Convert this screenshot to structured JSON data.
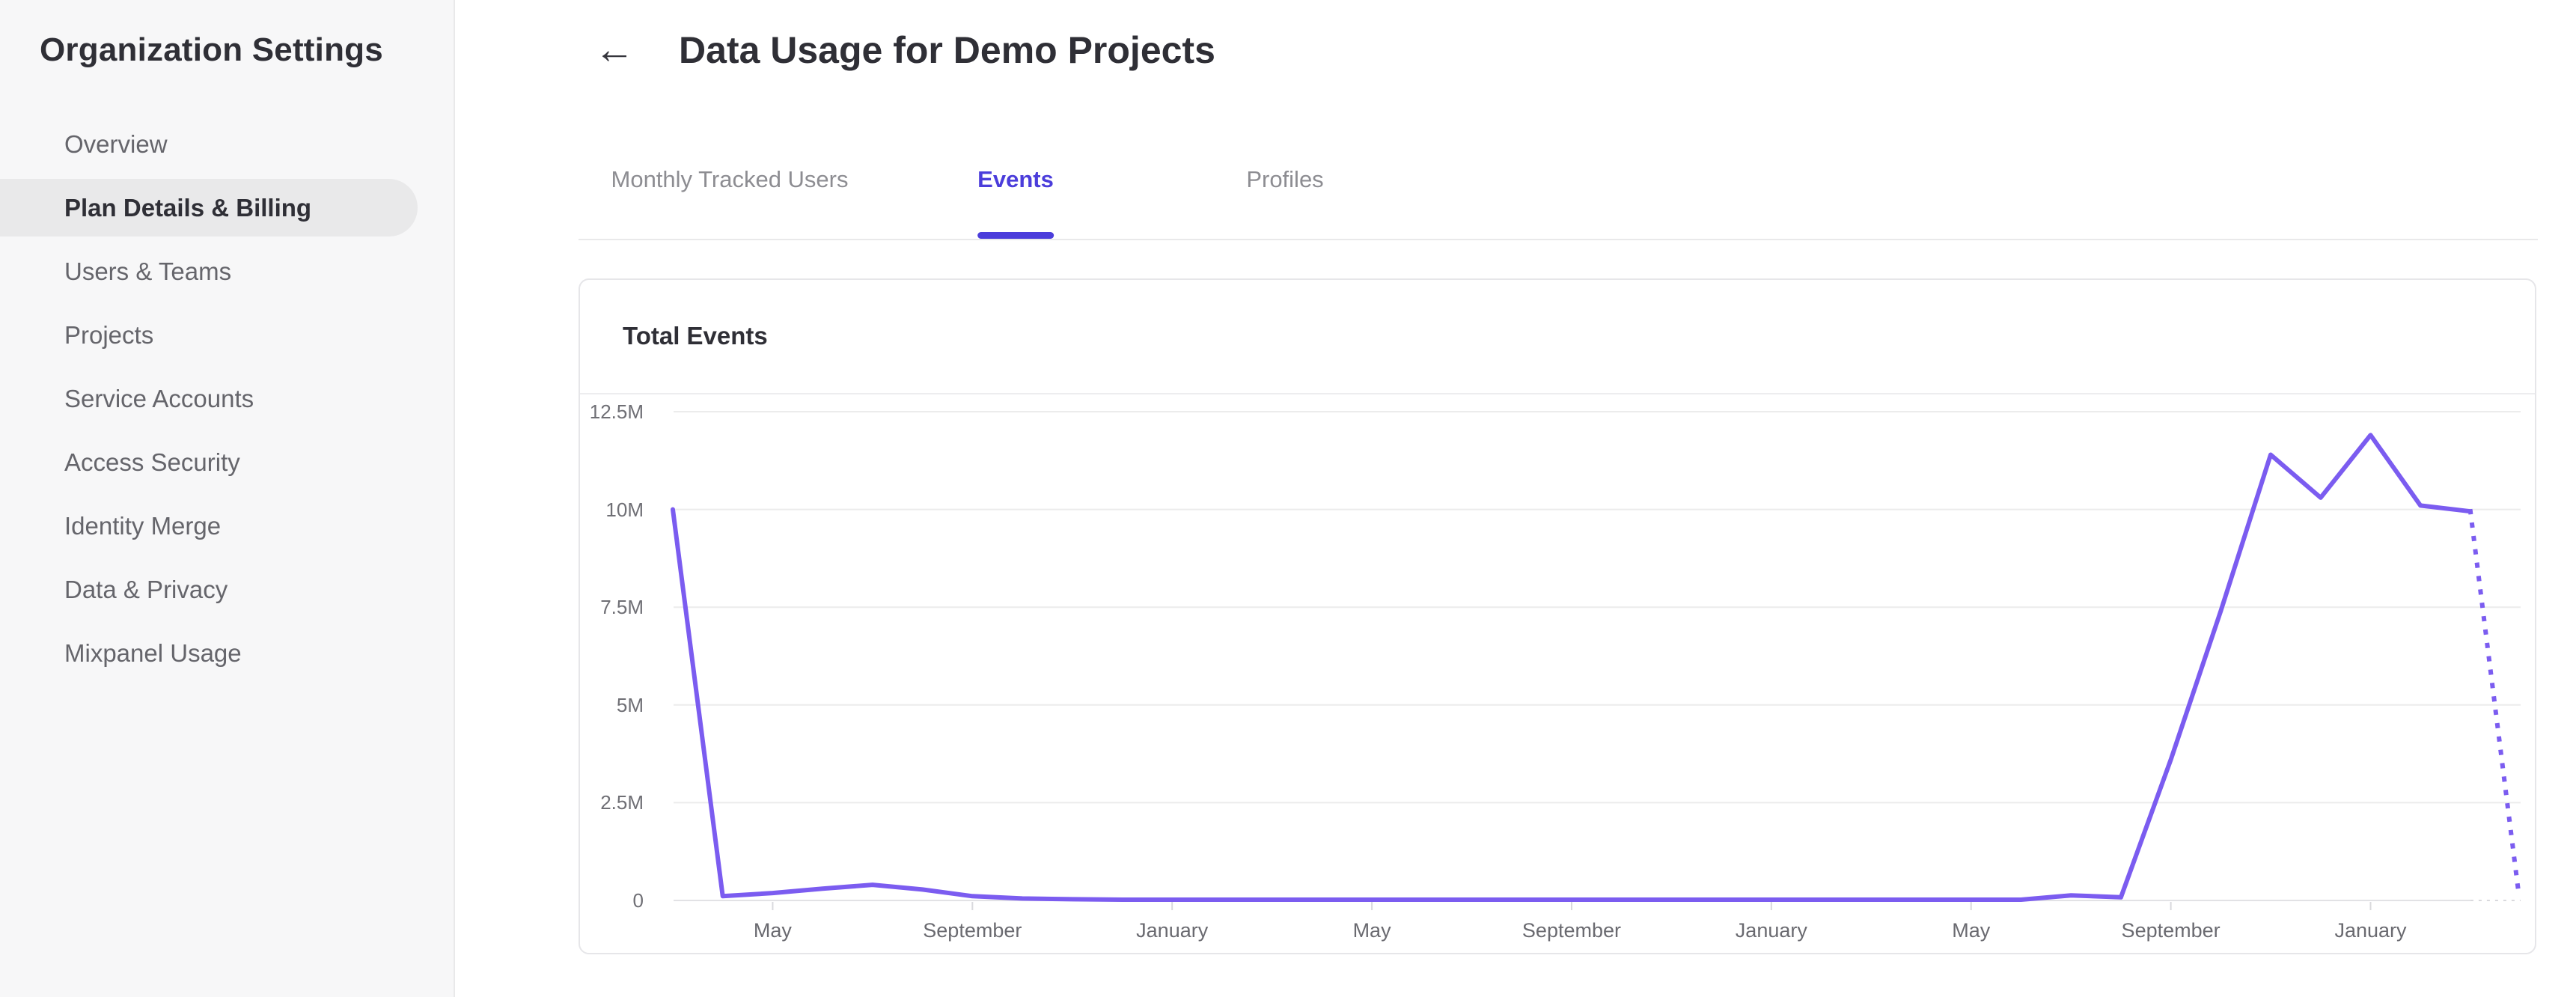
{
  "colors": {
    "accent": "#4b3ddb",
    "chart_line": "#7b5cf0",
    "sidebar_bg": "#f7f7f8",
    "pill": "#e9e9ea",
    "text_dark": "#2f2f36",
    "text_gray": "#65656b",
    "tab_inactive": "#8d8d92",
    "gridline": "#ececec",
    "axis_line": "#e2e2e5"
  },
  "sidebar": {
    "title": "Organization Settings",
    "items": [
      {
        "label": "Overview",
        "selected": false
      },
      {
        "label": "Plan Details & Billing",
        "selected": true
      },
      {
        "label": "Users & Teams",
        "selected": false
      },
      {
        "label": "Projects",
        "selected": false
      },
      {
        "label": "Service Accounts",
        "selected": false
      },
      {
        "label": "Access Security",
        "selected": false
      },
      {
        "label": "Identity Merge",
        "selected": false
      },
      {
        "label": "Data & Privacy",
        "selected": false
      },
      {
        "label": "Mixpanel Usage",
        "selected": false
      }
    ]
  },
  "header": {
    "back_icon": "←",
    "title": "Data Usage for Demo Projects"
  },
  "tabs": [
    {
      "label": "Monthly Tracked Users",
      "active": false
    },
    {
      "label": "Events",
      "active": true
    },
    {
      "label": "Profiles",
      "active": false
    }
  ],
  "card": {
    "title": "Total Events"
  },
  "chart_data": {
    "type": "line",
    "title": "Total Events",
    "xlabel": "",
    "ylabel": "",
    "legend": "none",
    "grid": "horizontal gridlines on, light gray",
    "ylim_millions": [
      0,
      12.5
    ],
    "y_tick_labels": [
      "0",
      "2.5M",
      "5M",
      "7.5M",
      "10M",
      "12.5M"
    ],
    "x_tick_labels": [
      "May",
      "September",
      "January",
      "May",
      "September",
      "January",
      "May",
      "September",
      "January"
    ],
    "x_ticks_every_n_points": 4,
    "first_tick_point_index": 2,
    "points_are": "monthly values, first point two months before first May tick",
    "series": [
      {
        "name": "Total Events",
        "line_style": "solid",
        "values_millions": [
          10,
          0.11,
          0.19,
          0.3,
          0.4,
          0.28,
          0.11,
          0.05,
          0.03,
          0.02,
          0.02,
          0.02,
          0.02,
          0.02,
          0.02,
          0.02,
          0.02,
          0.02,
          0.02,
          0.02,
          0.02,
          0.02,
          0.02,
          0.02,
          0.02,
          0.02,
          0.02,
          0.02,
          0.13,
          0.08,
          3.6,
          7.4,
          11.4,
          10.3,
          11.9,
          10.1,
          9.95
        ]
      }
    ],
    "projection": {
      "line_style": "dotted",
      "from_last_point": true,
      "months_after_last_point": 0.95,
      "end_value_millions": 0.35
    }
  }
}
